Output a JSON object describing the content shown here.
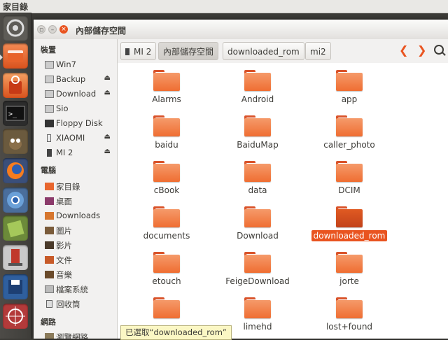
{
  "topbar": {
    "title": "家目錄"
  },
  "window": {
    "title": "內部儲存空間"
  },
  "sidebar": {
    "devices_heading": "裝置",
    "devices": [
      {
        "label": "Win7",
        "icon": "drive-icon",
        "eject": ""
      },
      {
        "label": "Backup",
        "icon": "drive-icon",
        "eject": "⏏"
      },
      {
        "label": "Download",
        "icon": "drive-icon",
        "eject": "⏏"
      },
      {
        "label": "Sio",
        "icon": "drive-icon",
        "eject": ""
      },
      {
        "label": "Floppy Disk",
        "icon": "floppy-icon",
        "eject": ""
      },
      {
        "label": "XIAOMI",
        "icon": "usb-icon",
        "eject": "⏏"
      },
      {
        "label": "MI 2",
        "icon": "phone-icon",
        "eject": "⏏"
      }
    ],
    "computer_heading": "電腦",
    "computer": [
      {
        "label": "家目錄",
        "icon": "home-icon"
      },
      {
        "label": "桌面",
        "icon": "desktop-icon"
      },
      {
        "label": "Downloads",
        "icon": "downloads-icon"
      },
      {
        "label": "圖片",
        "icon": "pictures-icon"
      },
      {
        "label": "影片",
        "icon": "videos-icon"
      },
      {
        "label": "文件",
        "icon": "documents-icon"
      },
      {
        "label": "音樂",
        "icon": "music-icon"
      },
      {
        "label": "檔案系統",
        "icon": "filesystem-icon"
      },
      {
        "label": "回收筒",
        "icon": "trash-icon"
      }
    ],
    "network_heading": "網路",
    "network": [
      {
        "label": "瀏覽網路",
        "icon": "network-icon"
      }
    ]
  },
  "pathbar": {
    "crumbs": [
      "MI 2",
      "內部儲存空間",
      "downloaded_rom",
      "mi2"
    ],
    "back": "❮",
    "forward": "❯"
  },
  "files": [
    "Alarms",
    "Android",
    "app",
    "baidu",
    "BaiduMap",
    "caller_photo",
    "cBook",
    "data",
    "DCIM",
    "documents",
    "Download",
    "downloaded_rom",
    "etouch",
    "FeigeDownload",
    "jorte",
    "",
    "limehd",
    "lost+found"
  ],
  "selected_file": "downloaded_rom",
  "status": "已選取“downloaded_rom”",
  "colors": {
    "accent": "#e95420",
    "folder": "#ef6e32"
  }
}
